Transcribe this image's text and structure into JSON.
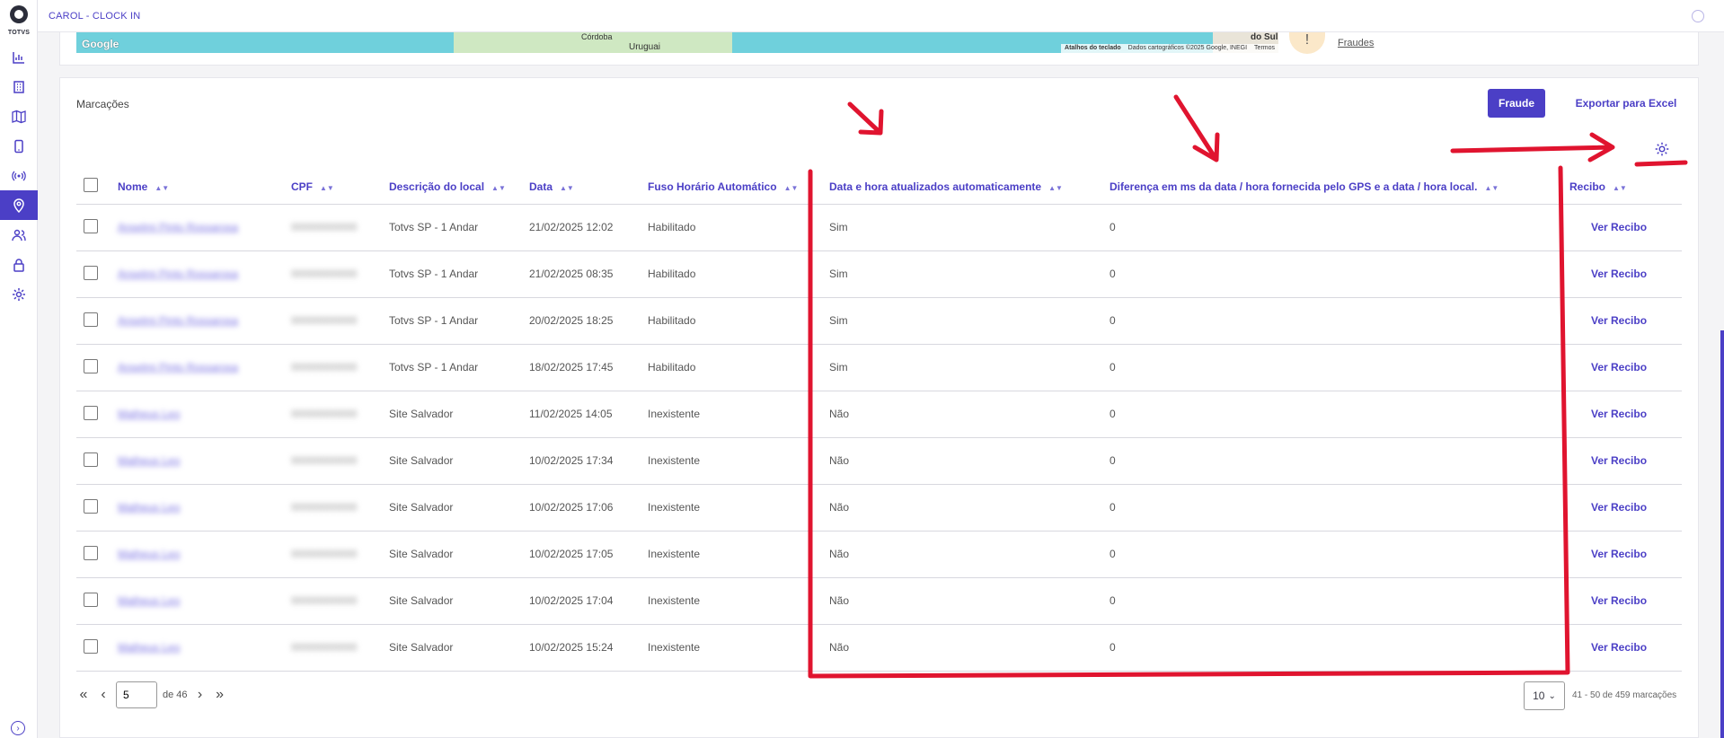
{
  "app": {
    "title": "CAROL - CLOCK IN",
    "logo_text": "TOTVS"
  },
  "sidebar": {
    "items": [
      {
        "icon": "chart-icon",
        "active": false
      },
      {
        "icon": "building-icon",
        "active": false
      },
      {
        "icon": "map-icon",
        "active": false
      },
      {
        "icon": "phone-icon",
        "active": false
      },
      {
        "icon": "broadcast-icon",
        "active": false
      },
      {
        "icon": "location-pin-icon",
        "active": true
      },
      {
        "icon": "users-icon",
        "active": false
      },
      {
        "icon": "lock-icon",
        "active": false
      },
      {
        "icon": "gear-icon",
        "active": false
      }
    ]
  },
  "map": {
    "google_label": "Google",
    "city_cordoba": "Córdoba",
    "city_uruguai": "Uruguai",
    "city_sul": "do Sul",
    "footer_shortcuts": "Atalhos do teclado",
    "footer_data": "Dados cartográficos ©2025 Google, INEGI",
    "footer_terms": "Termos",
    "fraud_link": "Fraudes",
    "fraud_icon": "!"
  },
  "panel": {
    "title": "Marcações",
    "fraud_button": "Fraude",
    "export_button": "Exportar para Excel"
  },
  "table": {
    "columns": [
      "Nome",
      "CPF",
      "Descrição do local",
      "Data",
      "Fuso Horário Automático",
      "Data e hora atualizados automaticamente",
      "Diferença em ms da data / hora fornecida pelo GPS e a data / hora local.",
      "Recibo"
    ],
    "rows": [
      {
        "name": "Anselmi Pinto Rossarosa",
        "cpf": "00000000000",
        "local": "Totvs SP - 1 Andar",
        "date": "21/02/2025 12:02",
        "tz": "Habilitado",
        "auto": "Sim",
        "diff": "0",
        "receipt": "Ver Recibo"
      },
      {
        "name": "Anselmi Pinto Rossarosa",
        "cpf": "00000000000",
        "local": "Totvs SP - 1 Andar",
        "date": "21/02/2025 08:35",
        "tz": "Habilitado",
        "auto": "Sim",
        "diff": "0",
        "receipt": "Ver Recibo"
      },
      {
        "name": "Anselmi Pinto Rossarosa",
        "cpf": "00000000000",
        "local": "Totvs SP - 1 Andar",
        "date": "20/02/2025 18:25",
        "tz": "Habilitado",
        "auto": "Sim",
        "diff": "0",
        "receipt": "Ver Recibo"
      },
      {
        "name": "Anselmi Pinto Rossarosa",
        "cpf": "00000000000",
        "local": "Totvs SP - 1 Andar",
        "date": "18/02/2025 17:45",
        "tz": "Habilitado",
        "auto": "Sim",
        "diff": "0",
        "receipt": "Ver Recibo"
      },
      {
        "name": "Matheus Leo",
        "cpf": "00000000000",
        "local": "Site Salvador",
        "date": "11/02/2025 14:05",
        "tz": "Inexistente",
        "auto": "Não",
        "diff": "0",
        "receipt": "Ver Recibo"
      },
      {
        "name": "Matheus Leo",
        "cpf": "00000000000",
        "local": "Site Salvador",
        "date": "10/02/2025 17:34",
        "tz": "Inexistente",
        "auto": "Não",
        "diff": "0",
        "receipt": "Ver Recibo"
      },
      {
        "name": "Matheus Leo",
        "cpf": "00000000000",
        "local": "Site Salvador",
        "date": "10/02/2025 17:06",
        "tz": "Inexistente",
        "auto": "Não",
        "diff": "0",
        "receipt": "Ver Recibo"
      },
      {
        "name": "Matheus Leo",
        "cpf": "00000000000",
        "local": "Site Salvador",
        "date": "10/02/2025 17:05",
        "tz": "Inexistente",
        "auto": "Não",
        "diff": "0",
        "receipt": "Ver Recibo"
      },
      {
        "name": "Matheus Leo",
        "cpf": "00000000000",
        "local": "Site Salvador",
        "date": "10/02/2025 17:04",
        "tz": "Inexistente",
        "auto": "Não",
        "diff": "0",
        "receipt": "Ver Recibo"
      },
      {
        "name": "Matheus Leo",
        "cpf": "00000000000",
        "local": "Site Salvador",
        "date": "10/02/2025 15:24",
        "tz": "Inexistente",
        "auto": "Não",
        "diff": "0",
        "receipt": "Ver Recibo"
      }
    ]
  },
  "pagination": {
    "page": "5",
    "of_label": "de 46",
    "per_page": "10",
    "range": "41 - 50 de 459 marcações"
  },
  "colors": {
    "accent": "#4b3fc6",
    "annotation": "#e0142f"
  }
}
